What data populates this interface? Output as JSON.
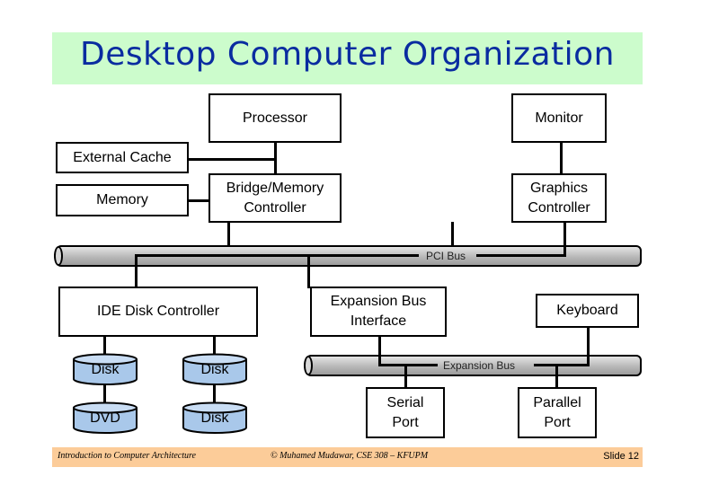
{
  "title": "Desktop Computer Organization",
  "colors": {
    "title_background": "#ccfccc",
    "title_text": "#0a2ca0",
    "footer_background": "#fccc99",
    "disk_fill": "#a9c8ea",
    "bus_fill": "#b8b8b8"
  },
  "components": {
    "processor": "Processor",
    "monitor": "Monitor",
    "external_cache": "External Cache",
    "memory": "Memory",
    "bridge_line1": "Bridge/Memory",
    "bridge_line2": "Controller",
    "graphics_line1": "Graphics",
    "graphics_line2": "Controller",
    "ide_controller": "IDE Disk Controller",
    "expansion_interface_line1": "Expansion Bus",
    "expansion_interface_line2": "Interface",
    "keyboard": "Keyboard",
    "serial_line1": "Serial",
    "serial_line2": "Port",
    "parallel_line1": "Parallel",
    "parallel_line2": "Port"
  },
  "buses": {
    "pci": "PCI Bus",
    "expansion": "Expansion Bus"
  },
  "drives": [
    {
      "label": "Disk"
    },
    {
      "label": "Disk"
    },
    {
      "label": "DVD"
    },
    {
      "label": "Disk"
    }
  ],
  "footer": {
    "course": "Introduction to Computer Architecture",
    "copyright": "© Muhamed Mudawar, CSE 308 – KFUPM",
    "slide": "Slide 12"
  }
}
